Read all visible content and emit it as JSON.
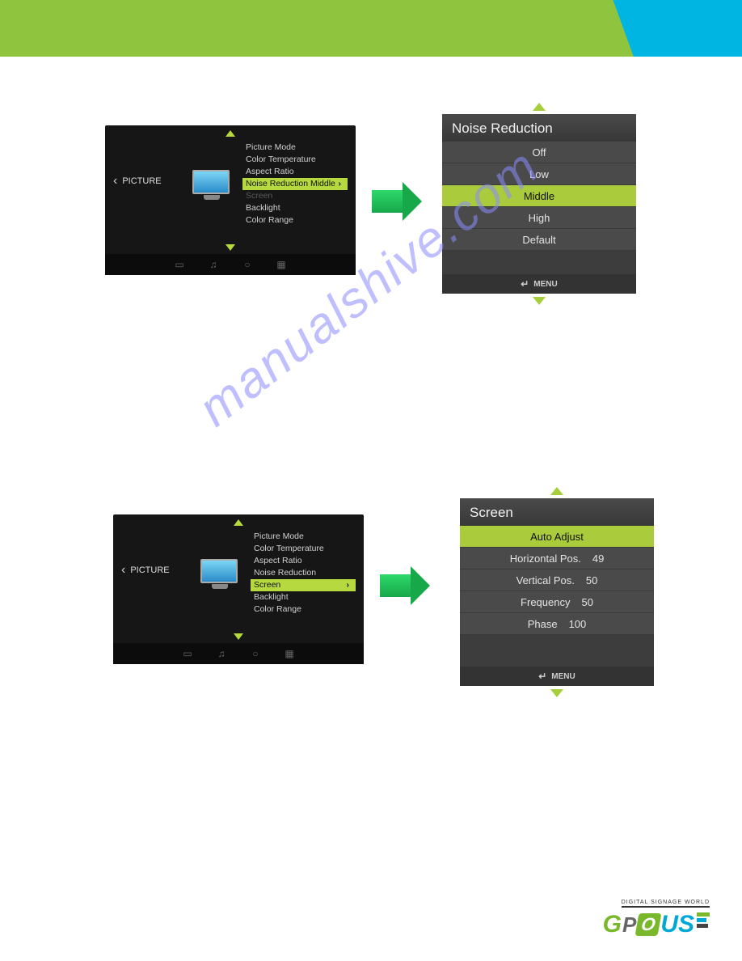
{
  "picture_panel_1": {
    "category": "PICTURE",
    "items": [
      {
        "label": "Picture Mode"
      },
      {
        "label": "Color Temperature"
      },
      {
        "label": "Aspect Ratio"
      },
      {
        "label": "Noise Reduction",
        "value": "Middle",
        "selected": true
      },
      {
        "label": "Screen",
        "dim": true
      },
      {
        "label": "Backlight"
      },
      {
        "label": "Color Range"
      }
    ]
  },
  "picture_panel_2": {
    "category": "PICTURE",
    "items": [
      {
        "label": "Picture Mode"
      },
      {
        "label": "Color Temperature"
      },
      {
        "label": "Aspect Ratio"
      },
      {
        "label": "Noise Reduction"
      },
      {
        "label": "Screen",
        "selected": true
      },
      {
        "label": "Backlight"
      },
      {
        "label": "Color Range"
      }
    ]
  },
  "submenu_1": {
    "title": "Noise Reduction",
    "options": [
      {
        "label": "Off"
      },
      {
        "label": "Low"
      },
      {
        "label": "Middle",
        "selected": true
      },
      {
        "label": "High"
      },
      {
        "label": "Default"
      }
    ],
    "footer": "MENU"
  },
  "submenu_2": {
    "title": "Screen",
    "options": [
      {
        "label": "Auto Adjust",
        "selected": true
      },
      {
        "label": "Horizontal Pos.",
        "value": "49"
      },
      {
        "label": "Vertical Pos.",
        "value": "50"
      },
      {
        "label": "Frequency",
        "value": "50"
      },
      {
        "label": "Phase",
        "value": "100"
      }
    ],
    "footer": "MENU"
  },
  "watermark": "manualshive.com",
  "footer": {
    "tagline": "DIGITAL SIGNAGE WORLD",
    "brand_g": "G",
    "brand_p": "P",
    "brand_o": "O",
    "brand_us": "US"
  }
}
